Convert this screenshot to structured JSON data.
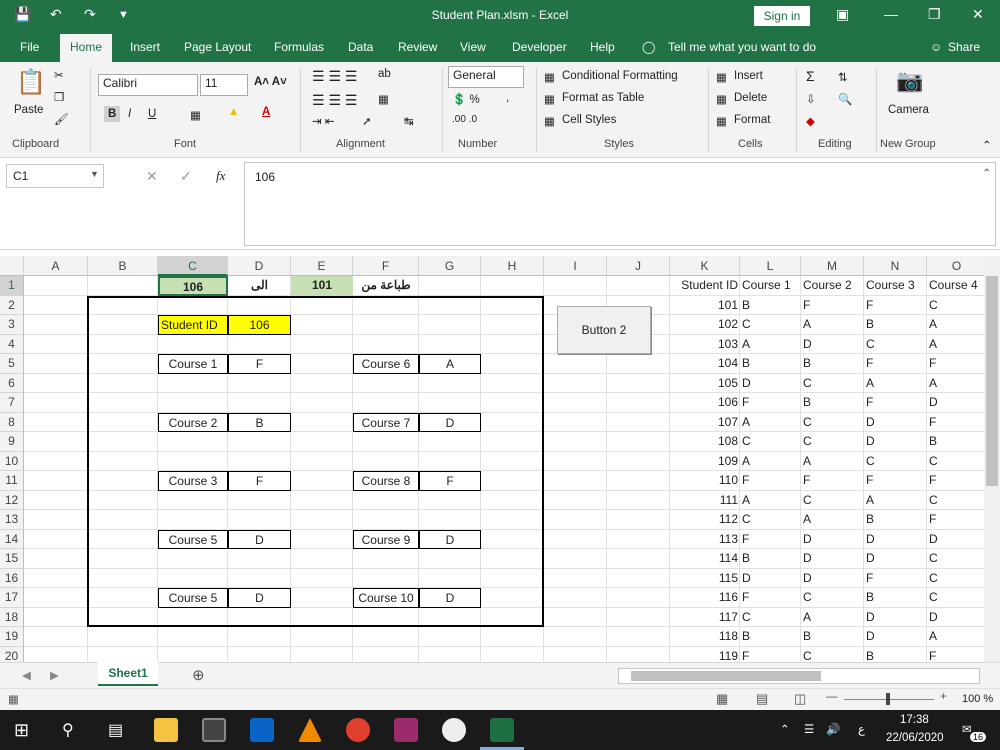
{
  "window": {
    "title": "Student Plan.xlsm  -  Excel",
    "sign_in": "Sign in"
  },
  "tabs": [
    "File",
    "Home",
    "Insert",
    "Page Layout",
    "Formulas",
    "Data",
    "Review",
    "View",
    "Developer",
    "Help"
  ],
  "tell_me": "Tell me what you want to do",
  "share": "Share",
  "ribbon": {
    "paste": "Paste",
    "font_name": "Calibri",
    "font_size": "11",
    "number_format": "General",
    "conditional_formatting": "Conditional Formatting",
    "format_as_table": "Format as Table",
    "cell_styles": "Cell Styles",
    "insert": "Insert",
    "delete": "Delete",
    "format": "Format",
    "camera": "Camera",
    "groups": [
      "Clipboard",
      "Font",
      "Alignment",
      "Number",
      "Styles",
      "Cells",
      "Editing",
      "New Group"
    ]
  },
  "formula_bar": {
    "name_box": "C1",
    "fx": "fx",
    "value": "106"
  },
  "columns": [
    "A",
    "B",
    "C",
    "D",
    "E",
    "F",
    "G",
    "H",
    "I",
    "J",
    "K",
    "L",
    "M",
    "N",
    "O"
  ],
  "rows": [
    "1",
    "2",
    "3",
    "4",
    "5",
    "6",
    "7",
    "8",
    "9",
    "10",
    "11",
    "12",
    "13",
    "14",
    "15",
    "16",
    "17",
    "18",
    "19",
    "20"
  ],
  "header_row": {
    "c": "106",
    "d": "الى",
    "e": "101",
    "f": "طباعة من"
  },
  "student_id": {
    "label": "Student ID",
    "value": "106"
  },
  "courses_left": [
    {
      "label": "Course 1",
      "grade": "F"
    },
    {
      "label": "Course 2",
      "grade": "B"
    },
    {
      "label": "Course 3",
      "grade": "F"
    },
    {
      "label": "Course 5",
      "grade": "D"
    },
    {
      "label": "Course 5",
      "grade": "D"
    }
  ],
  "courses_right": [
    {
      "label": "Course 6",
      "grade": "A"
    },
    {
      "label": "Course 7",
      "grade": "D"
    },
    {
      "label": "Course 8",
      "grade": "F"
    },
    {
      "label": "Course 9",
      "grade": "D"
    },
    {
      "label": "Course 10",
      "grade": "D"
    }
  ],
  "button2": "Button 2",
  "table_headers": [
    "Student ID",
    "Course 1",
    "Course 2",
    "Course 3",
    "Course 4"
  ],
  "table_rows": [
    [
      "101",
      "B",
      "F",
      "F",
      "C"
    ],
    [
      "102",
      "C",
      "A",
      "B",
      "A"
    ],
    [
      "103",
      "A",
      "D",
      "C",
      "A"
    ],
    [
      "104",
      "B",
      "B",
      "F",
      "F"
    ],
    [
      "105",
      "D",
      "C",
      "A",
      "A"
    ],
    [
      "106",
      "F",
      "B",
      "F",
      "D"
    ],
    [
      "107",
      "A",
      "C",
      "D",
      "F"
    ],
    [
      "108",
      "C",
      "C",
      "D",
      "B"
    ],
    [
      "109",
      "A",
      "A",
      "C",
      "C"
    ],
    [
      "110",
      "F",
      "F",
      "F",
      "F"
    ],
    [
      "111",
      "A",
      "C",
      "A",
      "C"
    ],
    [
      "112",
      "C",
      "A",
      "B",
      "F"
    ],
    [
      "113",
      "F",
      "D",
      "D",
      "D"
    ],
    [
      "114",
      "B",
      "D",
      "D",
      "C"
    ],
    [
      "115",
      "D",
      "D",
      "F",
      "C"
    ],
    [
      "116",
      "F",
      "C",
      "B",
      "C"
    ],
    [
      "117",
      "C",
      "A",
      "D",
      "D"
    ],
    [
      "118",
      "B",
      "B",
      "D",
      "A"
    ],
    [
      "119",
      "F",
      "C",
      "B",
      "F"
    ]
  ],
  "sheet_tab": "Sheet1",
  "zoom": "100 %",
  "taskbar": {
    "time": "17:38",
    "date": "22/06/2020",
    "lang": "ع",
    "notif": "16"
  }
}
